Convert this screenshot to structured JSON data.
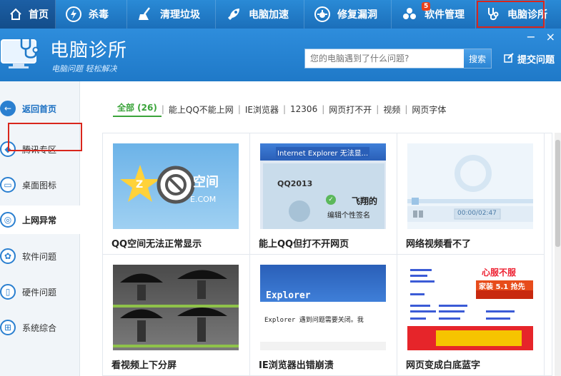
{
  "nav": {
    "tabs": [
      {
        "label": "首页",
        "icon": "home-icon"
      },
      {
        "label": "杀毒",
        "icon": "lightning-icon"
      },
      {
        "label": "清理垃圾",
        "icon": "broom-icon"
      },
      {
        "label": "电脑加速",
        "icon": "rocket-icon"
      },
      {
        "label": "修复漏洞",
        "icon": "bug-icon"
      },
      {
        "label": "软件管理",
        "icon": "cube-icon"
      },
      {
        "label": "电脑诊所",
        "icon": "stethoscope-icon"
      }
    ],
    "software_badge": "5",
    "active_tab": "电脑诊所"
  },
  "header": {
    "brand": "电脑诊所",
    "slogan": "电脑问题 轻松解决",
    "search_placeholder": "您的电脑遇到了什么问题?",
    "search_button": "搜索",
    "submit_label": "提交问题",
    "minimize": "−",
    "close": "×"
  },
  "sidebar": {
    "back": "返回首页",
    "items": [
      "腾讯专区",
      "桌面图标",
      "上网异常",
      "软件问题",
      "硬件问题",
      "系统综合"
    ],
    "active": "上网异常"
  },
  "filters": [
    {
      "label": "全部 (26)",
      "active": true
    },
    {
      "label": "能上QQ不能上网"
    },
    {
      "label": "IE浏览器"
    },
    {
      "label": "12306"
    },
    {
      "label": "网页打不开"
    },
    {
      "label": "视频"
    },
    {
      "label": "网页字体"
    }
  ],
  "cards": [
    {
      "title": "QQ空间无法正常显示",
      "thumb_text": "空间",
      "thumb_sub": "E.COM"
    },
    {
      "title": "能上QQ但打不开网页",
      "thumb_text": "Internet Explorer 无法显...",
      "thumb_sub": "QQ2013",
      "thumb_extra": "飞翔的",
      "thumb_extra2": "编辑个性签名"
    },
    {
      "title": "网络视频看不了",
      "thumb_time": "00:00/02:47"
    },
    {
      "title": "看视频上下分屏"
    },
    {
      "title": "IE浏览器出错崩溃",
      "thumb_text": "Explorer",
      "thumb_sub": "Explorer 遇到问题需要关闭。我"
    },
    {
      "title": "网页变成白底蓝字",
      "thumb_text": "心服不服",
      "thumb_sub": "家装 5.1 抢先"
    }
  ],
  "colors": {
    "accent": "#1f79c8",
    "active_green": "#3aa43a",
    "highlight_red": "#d9261c"
  }
}
